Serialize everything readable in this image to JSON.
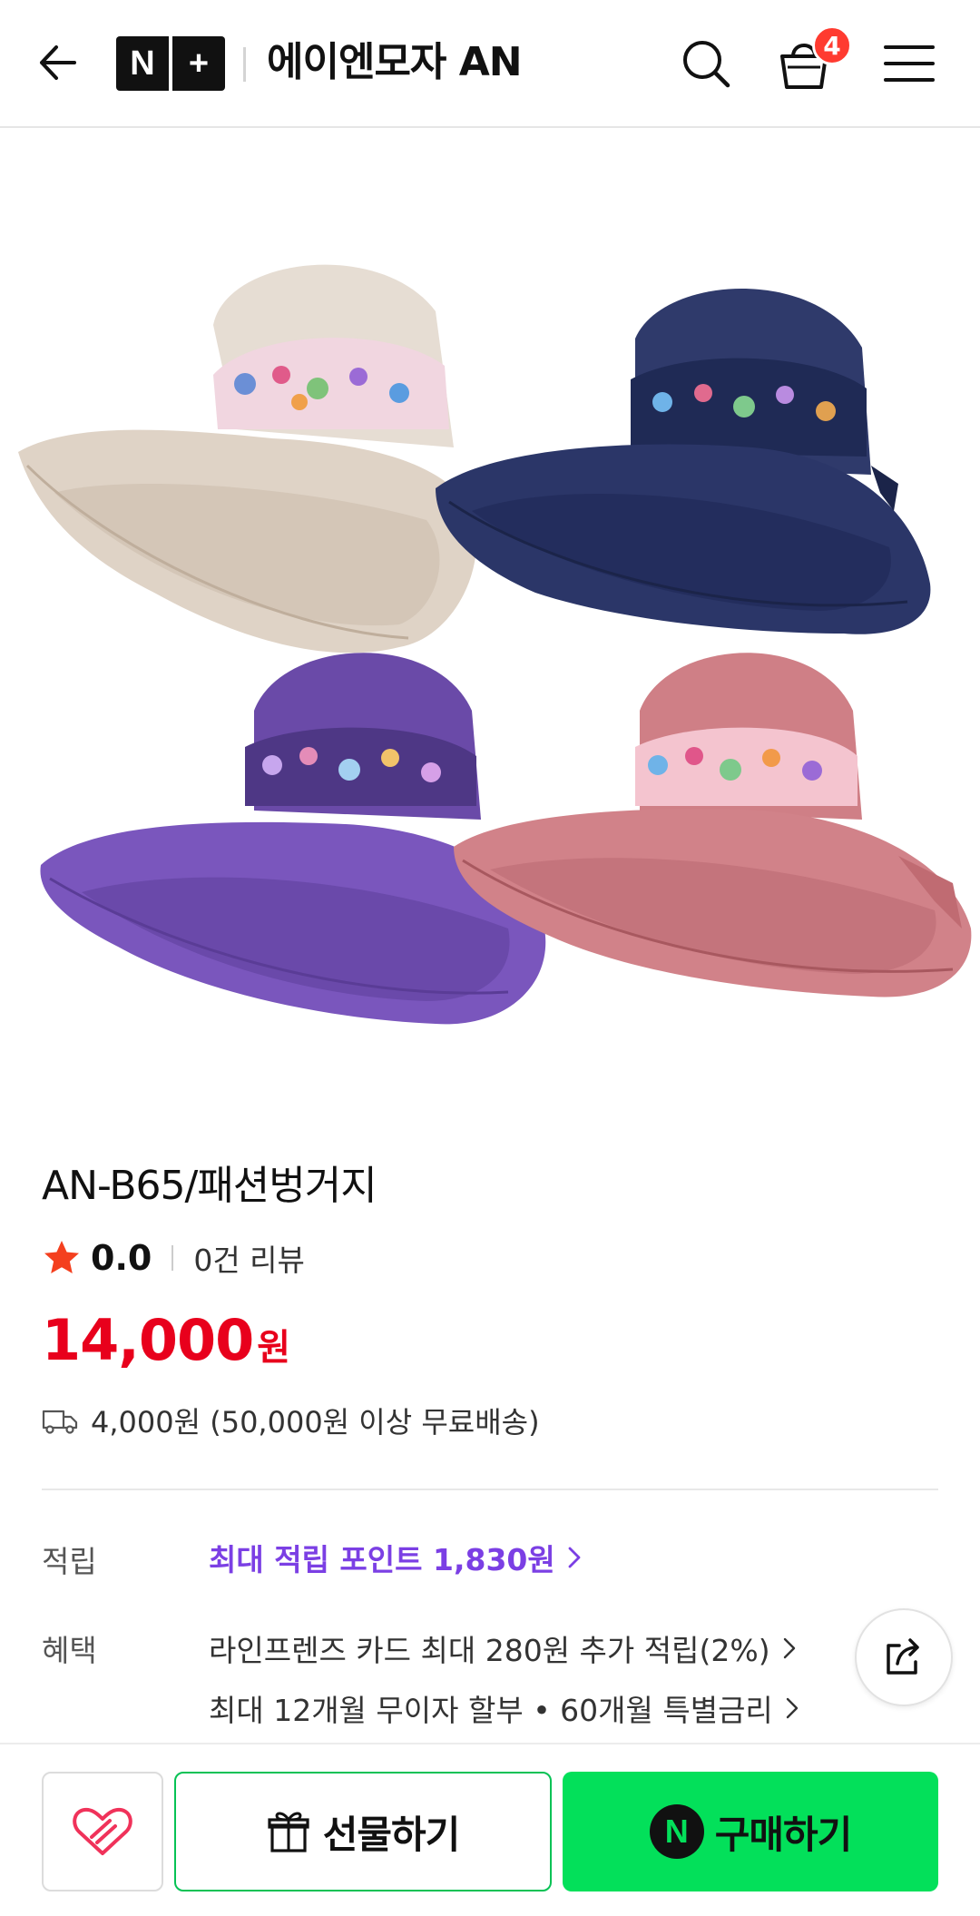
{
  "header": {
    "brand_n": "N",
    "brand_plus": "+",
    "store_name": "에이엔모자 AN",
    "cart_count": "4"
  },
  "product": {
    "title": "AN-B65/패션벙거지",
    "rating": "0.0",
    "reviews": "0건 리뷰",
    "price": "14,000",
    "currency": "원",
    "shipping": "4,000원 (50,000원 이상 무료배송)"
  },
  "benefits": {
    "points_label": "적립",
    "points_text": "최대 적립 포인트 1,830원",
    "benefit_label": "혜택",
    "benefit_1": "라인프렌즈 카드 최대 280원 추가 적립(2%)",
    "benefit_2": "최대 12개월 무이자 할부 • 60개월 특별금리"
  },
  "bottom": {
    "gift_label": "선물하기",
    "buy_n": "N",
    "buy_label": "구매하기"
  },
  "colors": {
    "price_red": "#e8001c",
    "points_purple": "#7b3fe4",
    "buy_green": "#03e05a",
    "badge_red": "#ff3b30"
  },
  "icons": [
    "back-arrow-icon",
    "search-icon",
    "shopping-bag-icon",
    "menu-icon",
    "star-icon",
    "truck-icon",
    "chevron-right-icon",
    "share-icon",
    "heart-icon",
    "gift-icon"
  ]
}
